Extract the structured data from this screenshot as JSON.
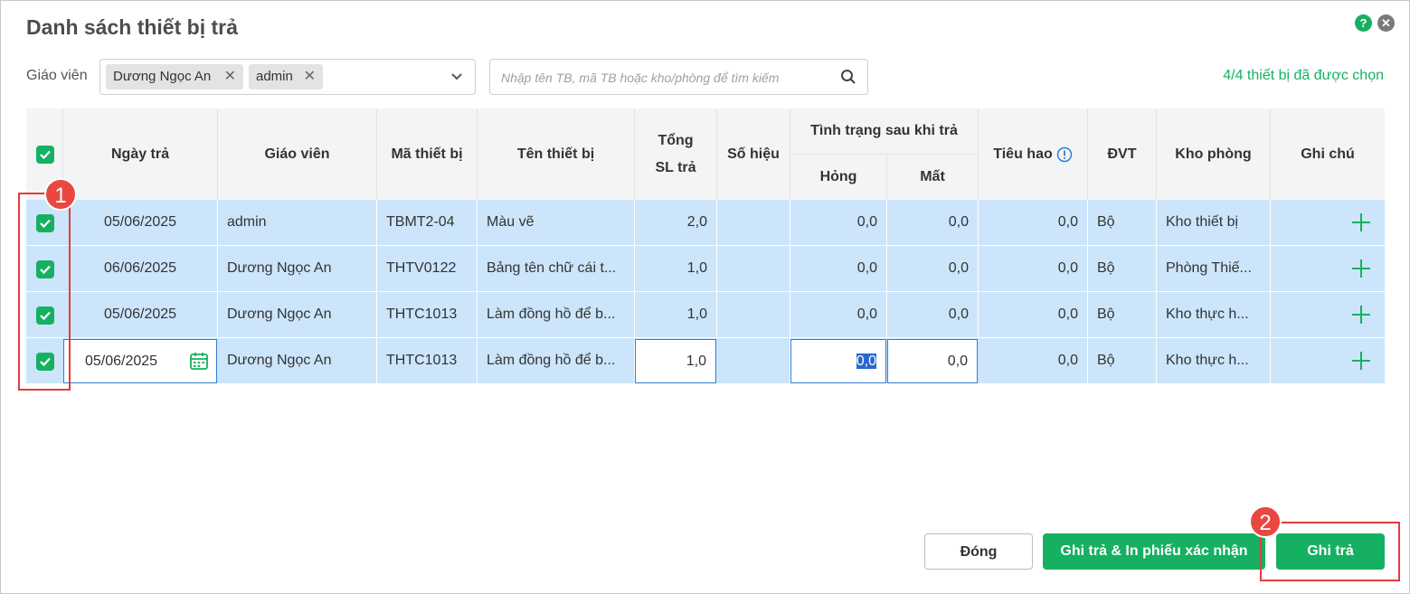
{
  "dialog": {
    "title": "Danh sách thiết bị trả",
    "help_icon": "question-circle-icon",
    "close_icon": "close-circle-icon"
  },
  "filters": {
    "teacher_label": "Giáo viên",
    "teacher_chips": [
      "Dương Ngọc An",
      "admin"
    ],
    "search_placeholder": "Nhập tên TB, mã TB hoặc kho/phòng để tìm kiếm",
    "selected_count": "4/4 thiết bị đã được chọn"
  },
  "table": {
    "headers": {
      "return_date": "Ngày trả",
      "teacher": "Giáo viên",
      "device_code": "Mã thiết bị",
      "device_name": "Tên thiết bị",
      "total_qty": "Tổng SL trả",
      "serial": "Số hiệu",
      "status_group": "Tình trạng sau khi trả",
      "damaged": "Hỏng",
      "lost": "Mất",
      "consumed": "Tiêu hao",
      "unit": "ĐVT",
      "warehouse": "Kho phòng",
      "note": "Ghi chú"
    },
    "rows": [
      {
        "date": "05/06/2025",
        "teacher": "admin",
        "code": "TBMT2-04",
        "name": "Màu vẽ",
        "qty": "2,0",
        "serial": "",
        "damaged": "0,0",
        "lost": "0,0",
        "consumed": "0,0",
        "unit": "Bộ",
        "warehouse": "Kho thiết bị",
        "checked": true
      },
      {
        "date": "06/06/2025",
        "teacher": "Dương Ngọc An",
        "code": "THTV0122",
        "name": "Bảng tên chữ cái t...",
        "qty": "1,0",
        "serial": "",
        "damaged": "0,0",
        "lost": "0,0",
        "consumed": "0,0",
        "unit": "Bộ",
        "warehouse": "Phòng Thiế...",
        "checked": true
      },
      {
        "date": "05/06/2025",
        "teacher": "Dương Ngọc An",
        "code": "THTC1013",
        "name": "Làm đồng hồ để b...",
        "qty": "1,0",
        "serial": "",
        "damaged": "0,0",
        "lost": "0,0",
        "consumed": "0,0",
        "unit": "Bộ",
        "warehouse": "Kho thực h...",
        "checked": true
      },
      {
        "date": "05/06/2025",
        "teacher": "Dương Ngọc An",
        "code": "THTC1013",
        "name": "Làm đồng hồ để b...",
        "qty": "1,0",
        "serial": "",
        "damaged": "0,0",
        "lost": "0,0",
        "consumed": "0,0",
        "unit": "Bộ",
        "warehouse": "Kho thực h...",
        "checked": true
      }
    ]
  },
  "buttons": {
    "close": "Đóng",
    "save_print": "Ghi trả & In phiếu xác nhận",
    "save": "Ghi trả"
  },
  "annotations": {
    "badge_1": "1",
    "badge_2": "2"
  },
  "colors": {
    "accent": "#16b062",
    "row_bg": "#cce5fb",
    "annotation": "#e23c3c"
  }
}
